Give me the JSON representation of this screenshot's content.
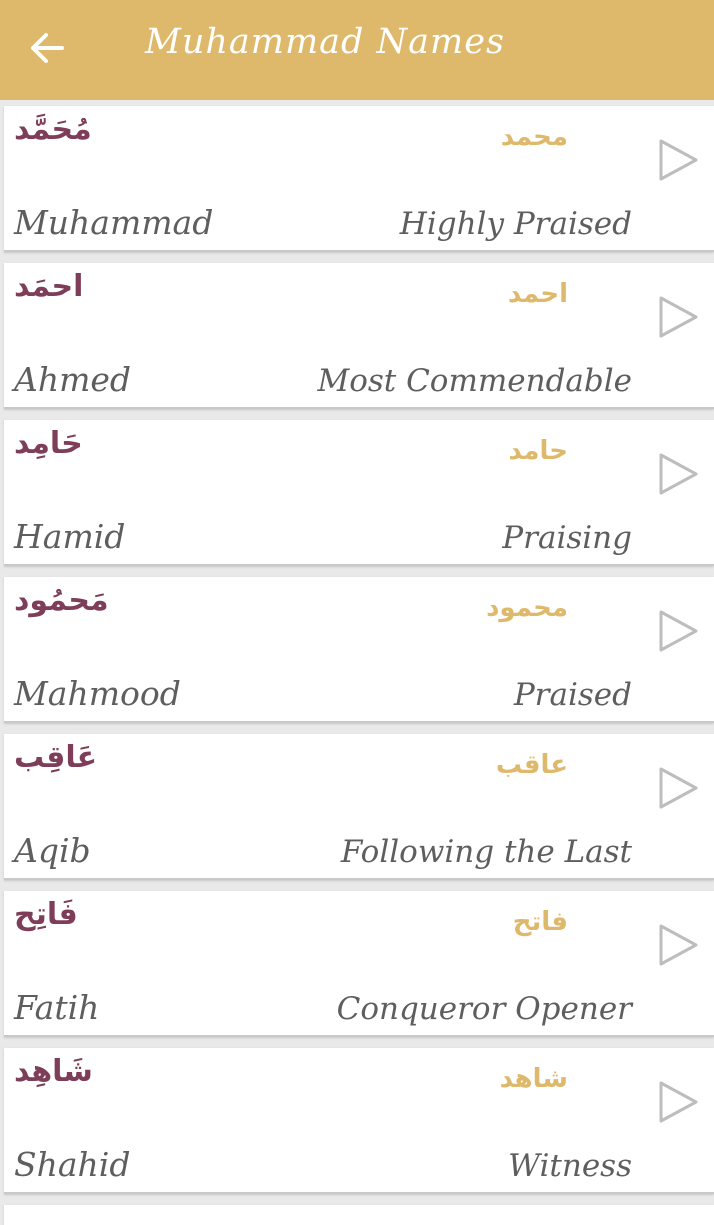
{
  "app": {
    "title": "Muhammad Names",
    "accent_color": "#dfb96b",
    "arabic_voweled_color": "#7e3e59",
    "text_color": "#5e5e5e"
  },
  "toolbar": {
    "back_icon": "arrow-left-icon"
  },
  "names": [
    {
      "arabic_voweled": "مُحَمَّد",
      "arabic": "محمد",
      "english": "Muhammad",
      "meaning": "Highly Praised",
      "action_icon": "play-icon"
    },
    {
      "arabic_voweled": "احمَد",
      "arabic": "احمد",
      "english": "Ahmed",
      "meaning": "Most Commendable",
      "action_icon": "play-icon"
    },
    {
      "arabic_voweled": "حَامِد",
      "arabic": "حامد",
      "english": "Hamid",
      "meaning": "Praising",
      "action_icon": "play-icon"
    },
    {
      "arabic_voweled": "مَحمُود",
      "arabic": "محمود",
      "english": "Mahmood",
      "meaning": "Praised",
      "action_icon": "play-icon"
    },
    {
      "arabic_voweled": "عَاقِب",
      "arabic": "عاقب",
      "english": "Aqib",
      "meaning": "Following the Last",
      "action_icon": "play-icon"
    },
    {
      "arabic_voweled": "فَاتِح",
      "arabic": "فاتح",
      "english": "Fatih",
      "meaning": "Conqueror Opener",
      "action_icon": "play-icon"
    },
    {
      "arabic_voweled": "شَاهِد",
      "arabic": "شاهد",
      "english": "Shahid",
      "meaning": "Witness",
      "action_icon": "play-icon"
    }
  ]
}
